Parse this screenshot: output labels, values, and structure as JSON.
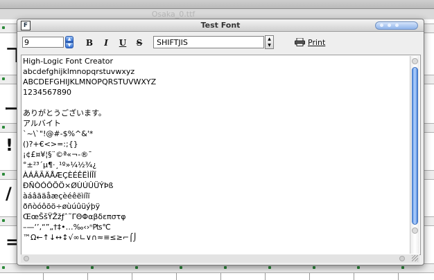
{
  "background": {
    "file_title": "Osaka_0.ttf",
    "glyphs": [
      "ヿ",
      "ー",
      "!",
      "/",
      "="
    ]
  },
  "window": {
    "title": "Test Font",
    "icon": "font-file-icon"
  },
  "toolbar": {
    "size_value": "9",
    "bold_label": "B",
    "italic_label": "I",
    "underline_label": "U",
    "strike_label": "S",
    "encoding_value": "SHIFTJIS",
    "print_label": "Print"
  },
  "text_lines": [
    "High-Logic Font Creator",
    "abcdefghijklmnopqrstuvwxyz",
    "ABCDEFGHIJKLMNOPQRSTUVWXYZ",
    "1234567890",
    "",
    "ありがとうございます。",
    "アルバイト",
    "`~\\`\"!@#-$%^&'*",
    "()?+€<>=:;{}",
    "¡¢£¤¥¦§¨©ª«¬-®¯",
    "°±²³´µ¶·¸¹º»¼½¾¿",
    "ÀÁÂÃÄÅÆÇÈÉÊËÌÍÎÏ",
    "ÐÑÒÓÔÕÖ×ØÙÚÛÜÝÞß",
    "àáâãäåæçèéêëìíîï",
    "ðñòóôõö÷øùúûüýþÿ",
    "ŒœŠšŸŽžƒˆ˜ΓΘΦαβδεπστφ",
    "–—‘’‚“”„†‡•…‰‹›ⁿ₧℃",
    "™Ω←↑↓↔↕√∞∟∨∩≈≡≤≥⌐⌠⌡"
  ]
}
